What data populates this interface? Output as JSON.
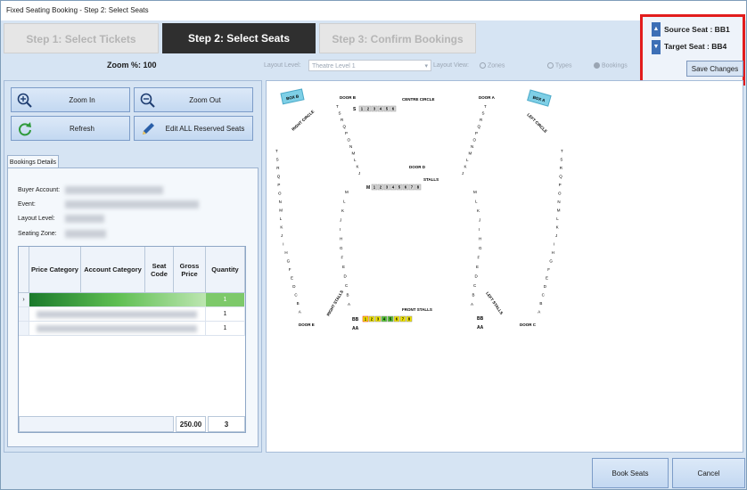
{
  "window": {
    "title": "Fixed Seating Booking - Step 2: Select Seats"
  },
  "steps": [
    {
      "label": "Step 1: Select Tickets",
      "state": "inactive"
    },
    {
      "label": "Step 2: Select Seats",
      "state": "active"
    },
    {
      "label": "Step 3: Confirm Bookings",
      "state": "inactive"
    }
  ],
  "seat_info": {
    "source": "Source Seat : BB1",
    "target": "Target Seat : BB4",
    "save_label": "Save Changes"
  },
  "toolbar": {
    "zoom_label": "Zoom %: 100",
    "layout_level_label": "Layout Level:",
    "layout_level_value": "Theatre Level 1",
    "layout_view_label": "Layout View:",
    "view_options": [
      "Zones",
      "Types",
      "Bookings"
    ],
    "selected_view": "Bookings"
  },
  "buttons": {
    "zoom_in": "Zoom In",
    "zoom_out": "Zoom Out",
    "refresh": "Refresh",
    "edit_reserved": "Edit ALL Reserved Seats",
    "book": "Book Seats",
    "cancel": "Cancel"
  },
  "details": {
    "tab": "Bookings Details",
    "labels": [
      "Buyer Account:",
      "Event:",
      "Layout Level:",
      "Seating Zone:"
    ]
  },
  "table": {
    "headers": [
      "Price Category",
      "Account Category",
      "Seat Code",
      "Gross Price",
      "Quantity"
    ],
    "rows": [
      {
        "quantity": "1"
      },
      {
        "quantity": "1"
      },
      {
        "quantity": "1"
      }
    ],
    "total_price": "250.00",
    "total_qty": "3"
  },
  "map": {
    "box_b": "BOX B",
    "box_a": "BOX A",
    "right_circle": "RIGHT CIRCLE",
    "left_circle": "LEFT CIRCLE",
    "door_b_top": "DOOR B",
    "door_a": "DOOR A",
    "centre_circle": "CENTRE CIRCLE",
    "row_s_label": "S",
    "circle_seats": [
      "1",
      "2",
      "3",
      "4",
      "5",
      "6"
    ],
    "door_d": "DOOR D",
    "stalls": "STALLS",
    "row_m_label": "M",
    "stall_seats": [
      "1",
      "2",
      "3",
      "4",
      "5",
      "6",
      "7",
      "8"
    ],
    "right_stalls": "RIGHT STALLS",
    "left_stalls": "LEFT STALLS",
    "door_e": "DOOR E",
    "door_c": "DOOR C",
    "front_stalls": "FRONT STALLS",
    "row_bb": "BB",
    "row_aa": "AA",
    "front_seats": [
      "1",
      "2",
      "3",
      "4",
      "5",
      "6",
      "7",
      "8"
    ],
    "front_seat_colors": [
      "#f2e600",
      "#f2e600",
      "#f2e600",
      "#52c234",
      "#52c234",
      "#f2e600",
      "#f2e600",
      "#f2e600"
    ],
    "left_side_letters": [
      "T",
      "S",
      "R",
      "Q",
      "P",
      "O",
      "N",
      "M",
      "L",
      "K",
      "J",
      "I",
      "H",
      "G",
      "F",
      "E",
      "D",
      "C",
      "B",
      "A"
    ],
    "inner_letters": [
      "M",
      "L",
      "K",
      "J",
      "I",
      "H",
      "G",
      "F",
      "E",
      "D",
      "C",
      "B",
      "A"
    ],
    "top_curve_letters": [
      "T",
      "S",
      "R",
      "Q",
      "P",
      "O",
      "N",
      "M",
      "L",
      "K",
      "J"
    ]
  }
}
